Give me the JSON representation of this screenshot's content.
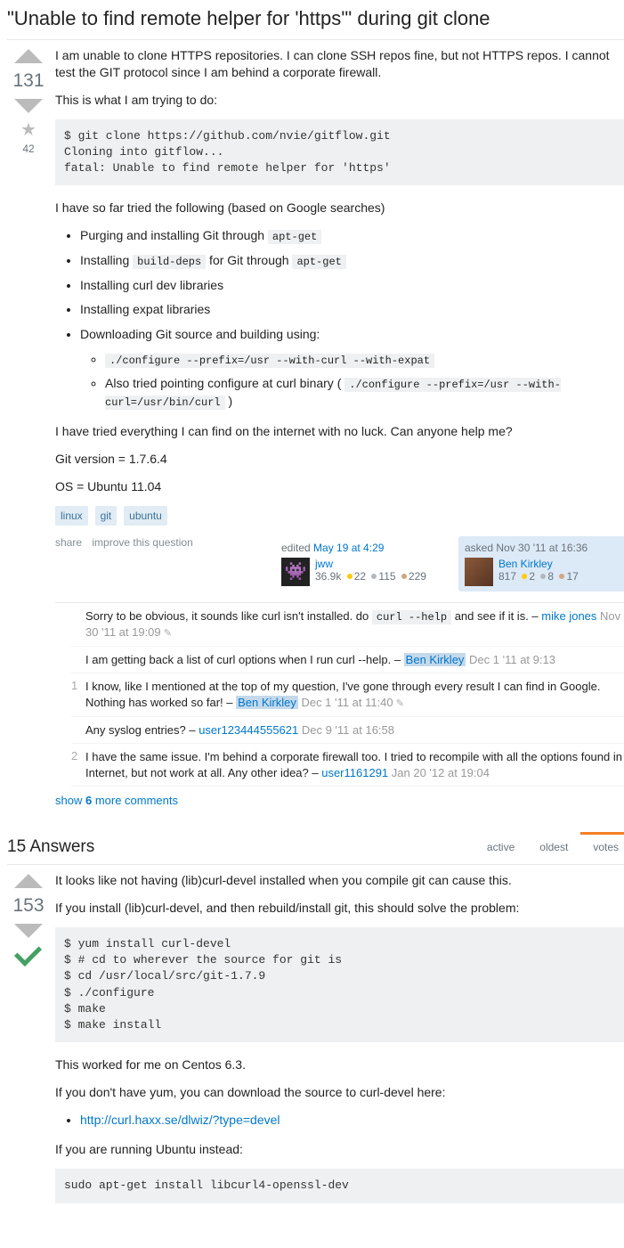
{
  "title": "\"Unable to find remote helper for 'https'\" during git clone",
  "question": {
    "score": "131",
    "fav": "42",
    "p1": "I am unable to clone HTTPS repositories. I can clone SSH repos fine, but not HTTPS repos. I cannot test the GIT protocol since I am behind a corporate firewall.",
    "p2": "This is what I am trying to do:",
    "code1": "$ git clone https://github.com/nvie/gitflow.git\nCloning into gitflow...\nfatal: Unable to find remote helper for 'https'",
    "p3": "I have so far tried the following (based on Google searches)",
    "b1a": "Purging and installing Git through ",
    "b1b": "apt-get",
    "b2a": "Installing ",
    "b2b": "build-deps",
    "b2c": " for Git through ",
    "b2d": "apt-get",
    "b3": "Installing curl dev libraries",
    "b4": "Installing expat libraries",
    "b5": "Downloading Git source and building using:",
    "b5a": "./configure --prefix=/usr --with-curl --with-expat",
    "b5b1": "Also tried pointing configure at curl binary ( ",
    "b5b2": "./configure --prefix=/usr --with-curl=/usr/bin/curl",
    "b5b3": " )",
    "p4": "I have tried everything I can find on the internet with no luck. Can anyone help me?",
    "p5": "Git version = 1.7.6.4",
    "p6": "OS = Ubuntu 11.04",
    "tags": [
      "linux",
      "git",
      "ubuntu"
    ],
    "menu": {
      "share": "share",
      "improve": "improve this question"
    },
    "edited": {
      "label": "edited ",
      "time": "May 19 at 4:29",
      "user": "jww",
      "rep": "36.9k",
      "g": "22",
      "s": "115",
      "b": "229"
    },
    "asked": {
      "label": "asked ",
      "time": "Nov 30 '11 at 16:36",
      "user": "Ben Kirkley",
      "rep": "817",
      "g": "2",
      "s": "8",
      "b": "17"
    }
  },
  "comments": [
    {
      "score": "",
      "t1": "Sorry to be obvious, it sounds like curl isn't installed. do ",
      "code": "curl --help",
      "t2": " and see if it is. – ",
      "user": "mike jones",
      "date": "Nov 30 '11 at 19:09",
      "pencil": true,
      "hl": false
    },
    {
      "score": "",
      "t1": "I am getting back a list of curl options when I run curl --help. – ",
      "code": "",
      "t2": "",
      "user": "Ben Kirkley",
      "date": "Dec 1 '11 at 9:13",
      "pencil": false,
      "hl": true
    },
    {
      "score": "1",
      "t1": "I know, like I mentioned at the top of my question, I've gone through every result I can find in Google. Nothing has worked so far! – ",
      "code": "",
      "t2": "",
      "user": "Ben Kirkley",
      "date": "Dec 1 '11 at 11:40",
      "pencil": true,
      "hl": true
    },
    {
      "score": "",
      "t1": "Any syslog entries? – ",
      "code": "",
      "t2": "",
      "user": "user123444555621",
      "date": "Dec 9 '11 at 16:58",
      "pencil": false,
      "hl": false
    },
    {
      "score": "2",
      "t1": "I have the same issue. I'm behind a corporate firewall too. I tried to recompile with all the options found in Internet, but not work at all. Any other idea? – ",
      "code": "",
      "t2": "",
      "user": "user1161291",
      "date": "Jan 20 '12 at 19:04",
      "pencil": false,
      "hl": false
    }
  ],
  "moreComments": {
    "a": "show ",
    "b": "6",
    "c": " more comments"
  },
  "answersHeader": {
    "count": "15 Answers",
    "tabs": [
      "active",
      "oldest",
      "votes"
    ]
  },
  "answer": {
    "score": "153",
    "p1": "It looks like not having (lib)curl-devel installed when you compile git can cause this.",
    "p2": "If you install (lib)curl-devel, and then rebuild/install git, this should solve the problem:",
    "code1": "$ yum install curl-devel\n$ # cd to wherever the source for git is\n$ cd /usr/local/src/git-1.7.9\n$ ./configure\n$ make\n$ make install",
    "p3": "This worked for me on Centos 6.3.",
    "p4": "If you don't have yum, you can download the source to curl-devel here:",
    "link": "http://curl.haxx.se/dlwiz/?type=devel",
    "p5": "If you are running Ubuntu instead:",
    "code2": "sudo apt-get install libcurl4-openssl-dev"
  }
}
